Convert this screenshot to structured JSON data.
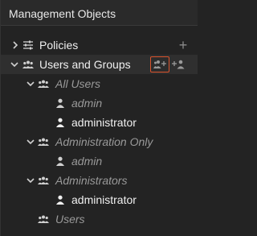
{
  "panel": {
    "title": "Management Objects"
  },
  "tree": {
    "policies": {
      "label": "Policies",
      "add_symbol": "+"
    },
    "users_and_groups": {
      "label": "Users and Groups"
    },
    "all_users": {
      "label": "All Users"
    },
    "all_users_admin": {
      "label": "admin"
    },
    "all_users_administrator": {
      "label": "administrator"
    },
    "administration_only": {
      "label": "Administration Only"
    },
    "administration_only_admin": {
      "label": "admin"
    },
    "administrators": {
      "label": "Administrators"
    },
    "administrators_administrator": {
      "label": "administrator"
    },
    "users": {
      "label": "Users"
    }
  },
  "colors": {
    "background": "#232323",
    "header": "#2a2a2a",
    "highlight_border": "#d9532c",
    "muted_text": "#9a9a9a",
    "bright_text": "#f0f0f0"
  },
  "icons": {
    "expand": "chevron-right-icon",
    "collapse": "chevron-down-icon",
    "policies": "sliders-icon",
    "group": "group-icon",
    "user": "user-icon",
    "add_group": "add-group-icon",
    "add_user": "add-user-icon"
  }
}
